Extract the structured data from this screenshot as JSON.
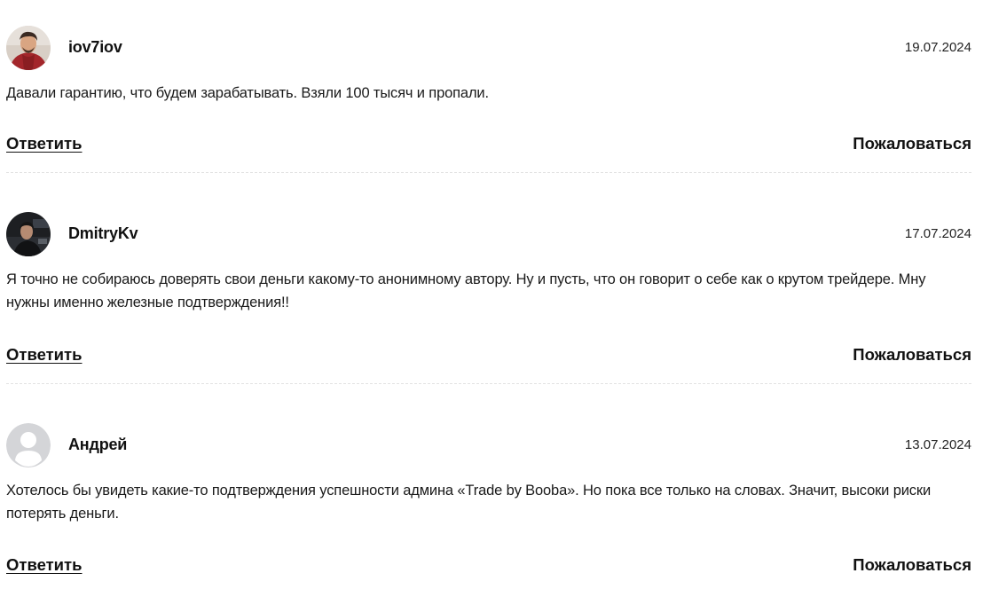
{
  "comments": [
    {
      "username": "iov7iov",
      "date": "19.07.2024",
      "text": "Давали гарантию, что будем зарабатывать. Взяли 100 тысяч и пропали.",
      "reply_label": "Ответить",
      "report_label": "Пожаловаться",
      "avatar": "photo-avatar-red-shirt"
    },
    {
      "username": "DmitryKv",
      "date": "17.07.2024",
      "text": "Я точно не собираюсь доверять свои деньги какому-то анонимному автору. Ну и пусть, что он говорит о себе как о крутом трейдере. Мну нужны именно железные подтверждения!!",
      "reply_label": "Ответить",
      "report_label": "Пожаловаться",
      "avatar": "photo-avatar-dark"
    },
    {
      "username": "Андрей",
      "date": "13.07.2024",
      "text": "Хотелось бы увидеть какие-то подтверждения успешности админа «Trade by Booba». Но пока все только на словах. Значит, высоки риски потерять деньги.",
      "reply_label": "Ответить",
      "report_label": "Пожаловаться",
      "avatar": "default-user-icon"
    }
  ]
}
